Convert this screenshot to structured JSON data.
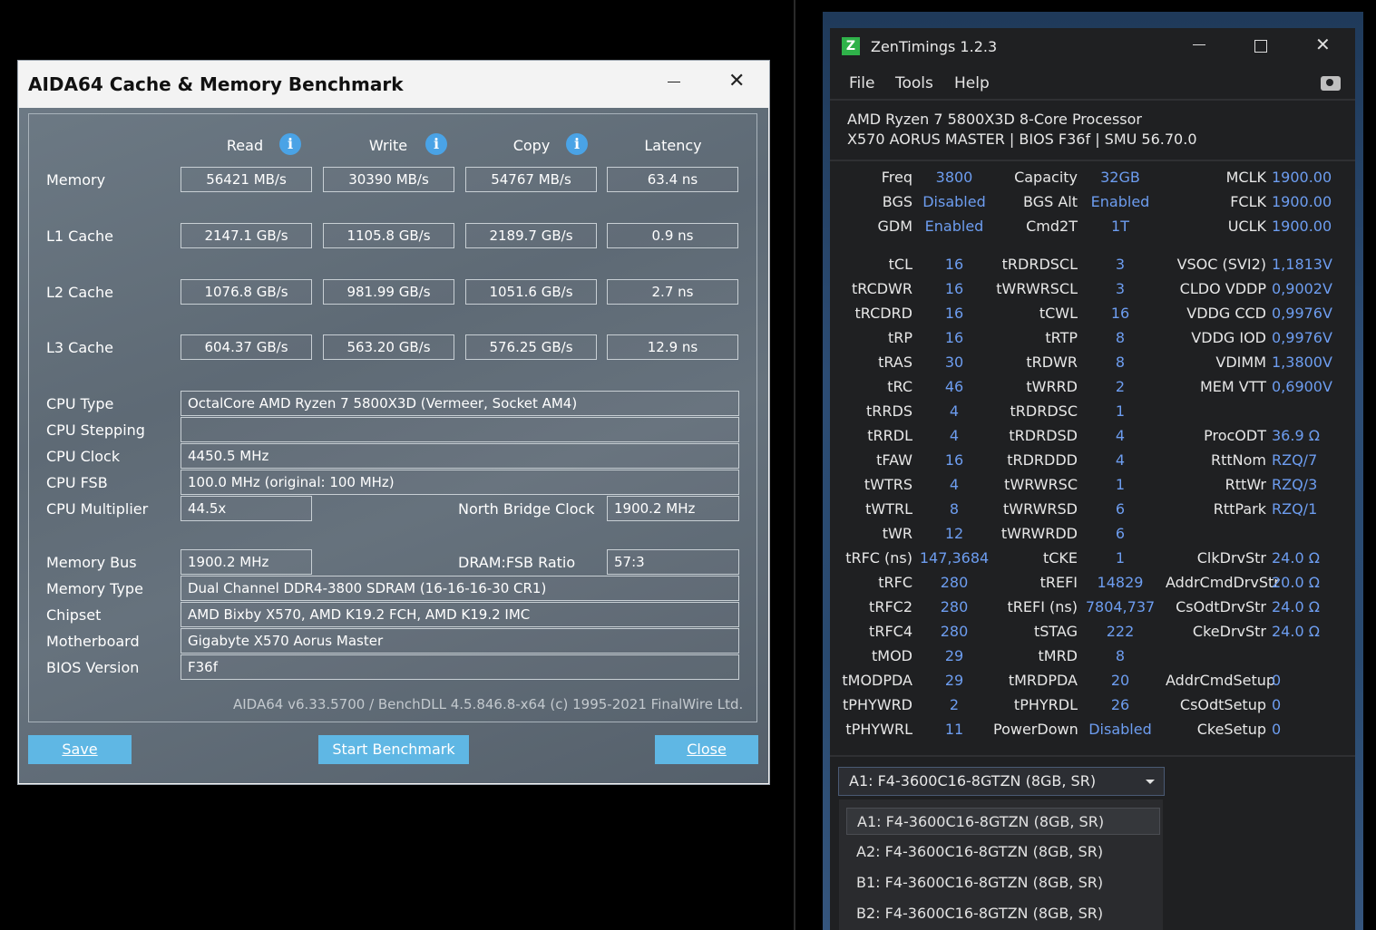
{
  "aida": {
    "title": "AIDA64 Cache & Memory Benchmark",
    "headers": {
      "read": "Read",
      "write": "Write",
      "copy": "Copy",
      "latency": "Latency"
    },
    "rows": [
      {
        "label": "Memory",
        "read": "56421 MB/s",
        "write": "30390 MB/s",
        "copy": "54767 MB/s",
        "latency": "63.4 ns"
      },
      {
        "label": "L1 Cache",
        "read": "2147.1 GB/s",
        "write": "1105.8 GB/s",
        "copy": "2189.7 GB/s",
        "latency": "0.9 ns"
      },
      {
        "label": "L2 Cache",
        "read": "1076.8 GB/s",
        "write": "981.99 GB/s",
        "copy": "1051.6 GB/s",
        "latency": "2.7 ns"
      },
      {
        "label": "L3 Cache",
        "read": "604.37 GB/s",
        "write": "563.20 GB/s",
        "copy": "576.25 GB/s",
        "latency": "12.9 ns"
      }
    ],
    "info": [
      {
        "label": "CPU Type",
        "value": "OctalCore AMD Ryzen 7 5800X3D  (Vermeer, Socket AM4)"
      },
      {
        "label": "CPU Stepping",
        "value": ""
      },
      {
        "label": "CPU Clock",
        "value": "4450.5 MHz"
      },
      {
        "label": "CPU FSB",
        "value": "100.0 MHz  (original: 100 MHz)"
      },
      {
        "label": "CPU Multiplier",
        "value": "44.5x"
      },
      {
        "label": "Memory Bus",
        "value": "1900.2 MHz"
      },
      {
        "label": "Memory Type",
        "value": "Dual Channel DDR4-3800 SDRAM  (16-16-16-30 CR1)"
      },
      {
        "label": "Chipset",
        "value": "AMD Bixby X570, AMD K19.2 FCH, AMD K19.2 IMC"
      },
      {
        "label": "Motherboard",
        "value": "Gigabyte X570 Aorus Master"
      },
      {
        "label": "BIOS Version",
        "value": "F36f"
      }
    ],
    "nb_clock_label": "North Bridge Clock",
    "nb_clock_value": "1900.2 MHz",
    "dram_ratio_label": "DRAM:FSB Ratio",
    "dram_ratio_value": "57:3",
    "footer": "AIDA64 v6.33.5700 / BenchDLL 4.5.846.8-x64  (c) 1995-2021 FinalWire Ltd.",
    "buttons": {
      "save": "Save",
      "start": "Start Benchmark",
      "close": "Close"
    }
  },
  "zen": {
    "title": "ZenTimings 1.2.3",
    "logo": "Z",
    "menu": [
      "File",
      "Tools",
      "Help"
    ],
    "cpu": "AMD Ryzen 7 5800X3D 8-Core Processor",
    "board": "X570 AORUS MASTER | BIOS F36f | SMU 56.70.0",
    "top": [
      [
        {
          "l": "Freq",
          "v": "3800"
        },
        {
          "l": "Capacity",
          "v": "32GB"
        },
        {
          "l": "MCLK",
          "v": "1900.00"
        }
      ],
      [
        {
          "l": "BGS",
          "v": "Disabled"
        },
        {
          "l": "BGS Alt",
          "v": "Enabled"
        },
        {
          "l": "FCLK",
          "v": "1900.00"
        }
      ],
      [
        {
          "l": "GDM",
          "v": "Enabled"
        },
        {
          "l": "Cmd2T",
          "v": "1T"
        },
        {
          "l": "UCLK",
          "v": "1900.00"
        }
      ]
    ],
    "timings": [
      [
        {
          "l": "tCL",
          "v": "16"
        },
        {
          "l": "tRDRDSCL",
          "v": "3"
        },
        {
          "l": "VSOC (SVI2)",
          "v": "1,1813V"
        }
      ],
      [
        {
          "l": "tRCDWR",
          "v": "16"
        },
        {
          "l": "tWRWRSCL",
          "v": "3"
        },
        {
          "l": "CLDO VDDP",
          "v": "0,9002V"
        }
      ],
      [
        {
          "l": "tRCDRD",
          "v": "16"
        },
        {
          "l": "tCWL",
          "v": "16"
        },
        {
          "l": "VDDG CCD",
          "v": "0,9976V"
        }
      ],
      [
        {
          "l": "tRP",
          "v": "16"
        },
        {
          "l": "tRTP",
          "v": "8"
        },
        {
          "l": "VDDG IOD",
          "v": "0,9976V"
        }
      ],
      [
        {
          "l": "tRAS",
          "v": "30"
        },
        {
          "l": "tRDWR",
          "v": "8"
        },
        {
          "l": "VDIMM",
          "v": "1,3800V"
        }
      ],
      [
        {
          "l": "tRC",
          "v": "46"
        },
        {
          "l": "tWRRD",
          "v": "2"
        },
        {
          "l": "MEM VTT",
          "v": "0,6900V"
        }
      ],
      [
        {
          "l": "tRRDS",
          "v": "4"
        },
        {
          "l": "tRDRDSC",
          "v": "1"
        },
        {
          "l": "",
          "v": ""
        }
      ],
      [
        {
          "l": "tRRDL",
          "v": "4"
        },
        {
          "l": "tRDRDSD",
          "v": "4"
        },
        {
          "l": "ProcODT",
          "v": "36.9 Ω"
        }
      ],
      [
        {
          "l": "tFAW",
          "v": "16"
        },
        {
          "l": "tRDRDDD",
          "v": "4"
        },
        {
          "l": "RttNom",
          "v": "RZQ/7"
        }
      ],
      [
        {
          "l": "tWTRS",
          "v": "4"
        },
        {
          "l": "tWRWRSC",
          "v": "1"
        },
        {
          "l": "RttWr",
          "v": "RZQ/3"
        }
      ],
      [
        {
          "l": "tWTRL",
          "v": "8"
        },
        {
          "l": "tWRWRSD",
          "v": "6"
        },
        {
          "l": "RttPark",
          "v": "RZQ/1"
        }
      ],
      [
        {
          "l": "tWR",
          "v": "12"
        },
        {
          "l": "tWRWRDD",
          "v": "6"
        },
        {
          "l": "",
          "v": ""
        }
      ],
      [
        {
          "l": "tRFC (ns)",
          "v": "147,3684"
        },
        {
          "l": "tCKE",
          "v": "1"
        },
        {
          "l": "ClkDrvStr",
          "v": "24.0 Ω"
        }
      ],
      [
        {
          "l": "tRFC",
          "v": "280"
        },
        {
          "l": "tREFI",
          "v": "14829"
        },
        {
          "l": "AddrCmdDrvStr",
          "v": "20.0 Ω"
        }
      ],
      [
        {
          "l": "tRFC2",
          "v": "280"
        },
        {
          "l": "tREFI (ns)",
          "v": "7804,737"
        },
        {
          "l": "CsOdtDrvStr",
          "v": "24.0 Ω"
        }
      ],
      [
        {
          "l": "tRFC4",
          "v": "280"
        },
        {
          "l": "tSTAG",
          "v": "222"
        },
        {
          "l": "CkeDrvStr",
          "v": "24.0 Ω"
        }
      ],
      [
        {
          "l": "tMOD",
          "v": "29"
        },
        {
          "l": "tMRD",
          "v": "8"
        },
        {
          "l": "",
          "v": ""
        }
      ],
      [
        {
          "l": "tMODPDA",
          "v": "29"
        },
        {
          "l": "tMRDPDA",
          "v": "20"
        },
        {
          "l": "AddrCmdSetup",
          "v": "0"
        }
      ],
      [
        {
          "l": "tPHYWRD",
          "v": "2"
        },
        {
          "l": "tPHYRDL",
          "v": "26"
        },
        {
          "l": "CsOdtSetup",
          "v": "0"
        }
      ],
      [
        {
          "l": "tPHYWRL",
          "v": "11"
        },
        {
          "l": "PowerDown",
          "v": "Disabled"
        },
        {
          "l": "CkeSetup",
          "v": "0"
        }
      ]
    ],
    "dimm_selected": "A1: F4-3600C16-8GTZN (8GB, SR)",
    "dimm_options": [
      "A1: F4-3600C16-8GTZN (8GB, SR)",
      "A2: F4-3600C16-8GTZN (8GB, SR)",
      "B1: F4-3600C16-8GTZN (8GB, SR)",
      "B2: F4-3600C16-8GTZN (8GB, SR)"
    ]
  }
}
